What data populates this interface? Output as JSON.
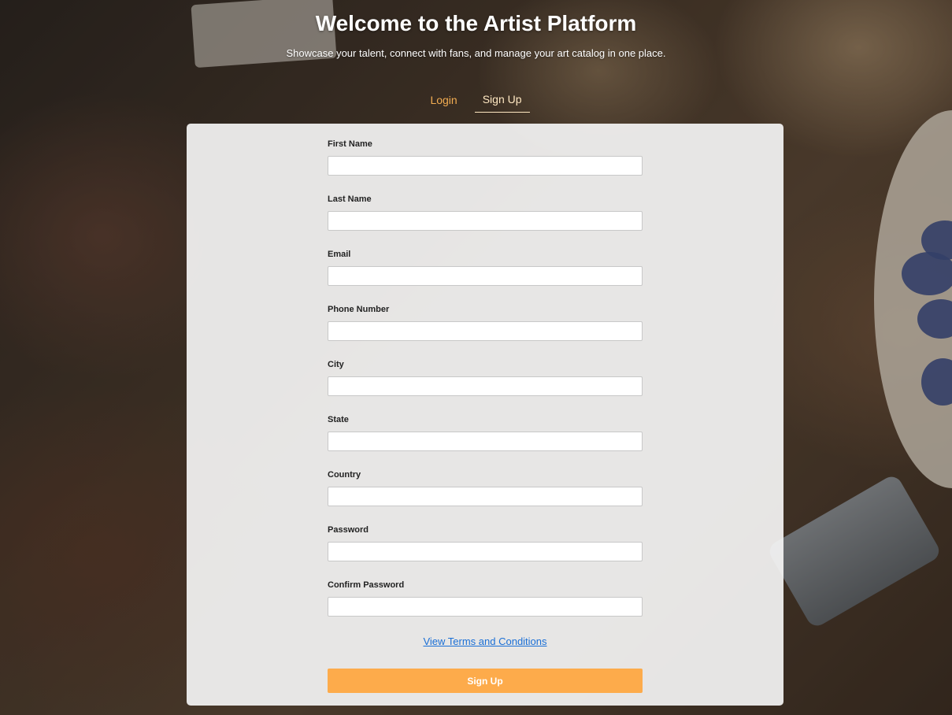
{
  "header": {
    "title": "Welcome to the Artist Platform",
    "subtitle": "Showcase your talent, connect with fans, and manage your art catalog in one place."
  },
  "tabs": [
    {
      "label": "Login",
      "active": false
    },
    {
      "label": "Sign Up",
      "active": true
    }
  ],
  "form": {
    "fields": [
      {
        "label": "First Name",
        "value": ""
      },
      {
        "label": "Last Name",
        "value": ""
      },
      {
        "label": "Email",
        "value": ""
      },
      {
        "label": "Phone Number",
        "value": ""
      },
      {
        "label": "City",
        "value": ""
      },
      {
        "label": "State",
        "value": ""
      },
      {
        "label": "Country",
        "value": ""
      },
      {
        "label": "Password",
        "value": ""
      },
      {
        "label": "Confirm Password",
        "value": ""
      }
    ],
    "terms_link": "View Terms and Conditions",
    "submit_label": "Sign Up"
  },
  "colors": {
    "accent": "#fdab4b",
    "tab_inactive": "#f3ad52",
    "link": "#1a6fd6"
  }
}
